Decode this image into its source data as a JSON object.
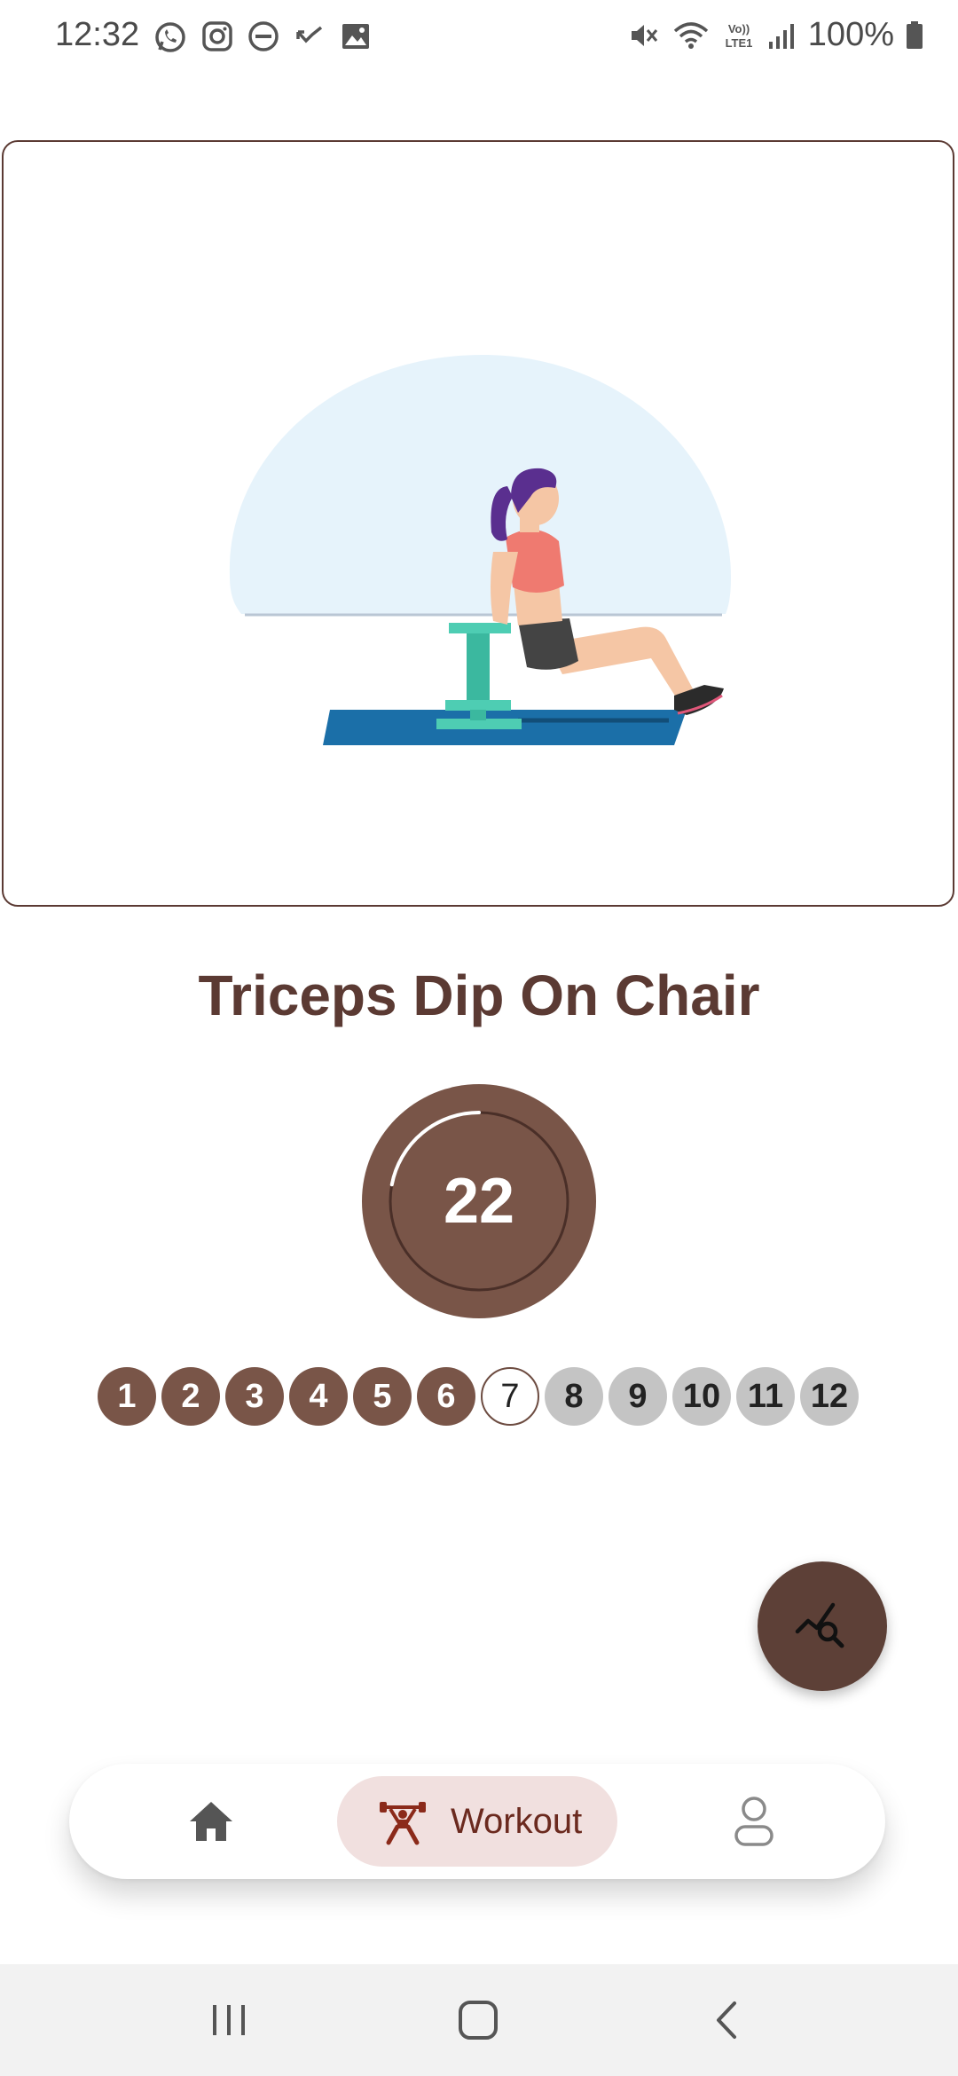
{
  "status_bar": {
    "time": "12:32",
    "left_icons": [
      "whatsapp-icon",
      "instagram-icon",
      "do-not-disturb-icon",
      "missed-call-icon",
      "gallery-icon"
    ],
    "right_icons": [
      "mute-icon",
      "wifi-icon",
      "volte-lte-icon",
      "signal-icon"
    ],
    "battery_text": "100%"
  },
  "exercise": {
    "title": "Triceps Dip On Chair",
    "illustration": "woman-doing-triceps-dip-illustration"
  },
  "timer": {
    "value": "22",
    "progress_fraction": 0.22
  },
  "sets": [
    {
      "label": "1",
      "state": "done"
    },
    {
      "label": "2",
      "state": "done"
    },
    {
      "label": "3",
      "state": "done"
    },
    {
      "label": "4",
      "state": "done"
    },
    {
      "label": "5",
      "state": "done"
    },
    {
      "label": "6",
      "state": "done"
    },
    {
      "label": "7",
      "state": "current"
    },
    {
      "label": "8",
      "state": "pending"
    },
    {
      "label": "9",
      "state": "pending"
    },
    {
      "label": "10",
      "state": "pending"
    },
    {
      "label": "11",
      "state": "pending"
    },
    {
      "label": "12",
      "state": "pending"
    }
  ],
  "fab": {
    "icon": "query-stats-icon"
  },
  "bottom_nav": {
    "home_icon": "home-icon",
    "workout_icon": "fitness-icon",
    "workout_label": "Workout",
    "profile_icon": "profile-icon",
    "active": "workout"
  },
  "system_nav": {
    "recents": "recents-icon",
    "home": "home-square-icon",
    "back": "back-icon"
  },
  "colors": {
    "primary": "#795548",
    "dark": "#5d4037",
    "title": "#5b3a33",
    "pending": "#c4c4c4",
    "nav_active_bg": "#f1e0df",
    "nav_active_fg": "#6b2a1f"
  }
}
